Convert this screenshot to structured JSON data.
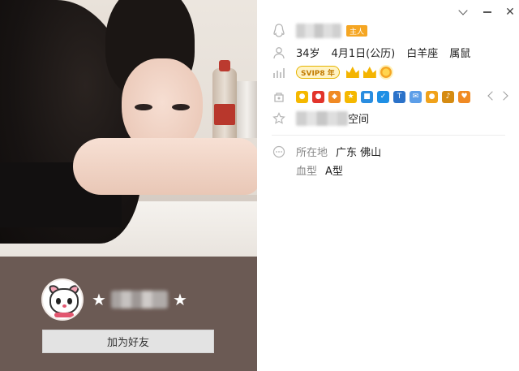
{
  "left": {
    "nickname_prefix": "★",
    "nickname_suffix": "★",
    "add_friend_label": "加为好友"
  },
  "info": {
    "owner_badge": "主人",
    "age": "34岁",
    "birthday": "4月1日(公历)",
    "constellation": "白羊座",
    "zodiac": "属鼠",
    "svip_label": "SVIP8 年",
    "qzone_suffix": "空间",
    "location_label": "所在地",
    "location_value": "广东 佛山",
    "blood_label": "血型",
    "blood_value": "A型"
  },
  "service_icons": [
    {
      "name": "qq-penguin-icon",
      "color": "#f5b800",
      "glyph": "●"
    },
    {
      "name": "red-penguin-icon",
      "color": "#e2342b",
      "glyph": "●"
    },
    {
      "name": "game-icon",
      "color": "#f08a24",
      "glyph": "◆"
    },
    {
      "name": "star-icon",
      "color": "#f5b800",
      "glyph": "★"
    },
    {
      "name": "camera-icon",
      "color": "#2a8de0",
      "glyph": "■"
    },
    {
      "name": "shield-icon",
      "color": "#1e8fe5",
      "glyph": "✓"
    },
    {
      "name": "security-icon",
      "color": "#2b72c9",
      "glyph": "T"
    },
    {
      "name": "mail-icon",
      "color": "#5c9ee8",
      "glyph": "✉"
    },
    {
      "name": "pet-icon",
      "color": "#f0a21b",
      "glyph": "●"
    },
    {
      "name": "music-icon",
      "color": "#d58b12",
      "glyph": "♪"
    },
    {
      "name": "vip-shield-icon",
      "color": "#f08a24",
      "glyph": "♥"
    }
  ]
}
